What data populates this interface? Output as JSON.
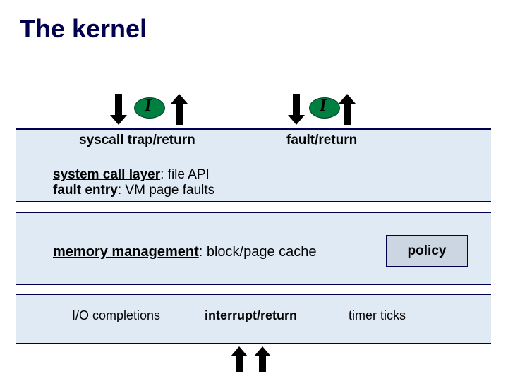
{
  "title": "The kernel",
  "top_labels": {
    "syscall": "syscall trap/return",
    "fault": "fault/return"
  },
  "layer1": {
    "line1_prefix": "system call layer",
    "line1_rest": ": file API",
    "line2_prefix": "fault entry",
    "line2_rest": ": VM page faults"
  },
  "layer2": {
    "mem_prefix": "memory management",
    "mem_rest": ": block/page cache",
    "policy": "policy"
  },
  "layer3": {
    "io": "I/O completions",
    "interrupt": "interrupt/return",
    "timer": "timer ticks"
  },
  "ellipse_glyph": "I"
}
